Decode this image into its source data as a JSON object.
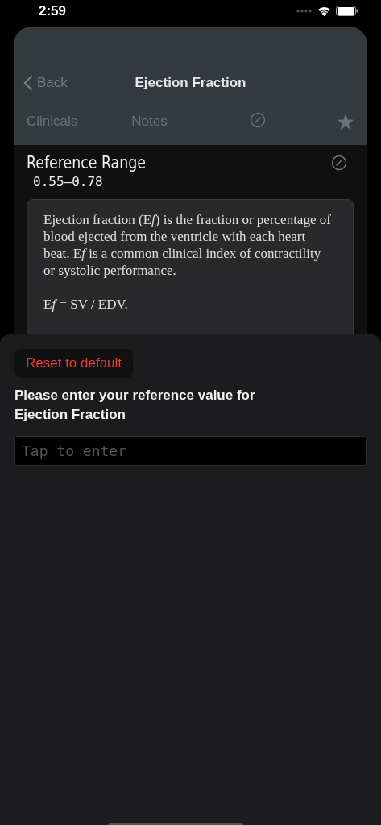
{
  "status_bar": {
    "time": "2:59"
  },
  "nav": {
    "back": "Back",
    "title": "Ejection Fraction"
  },
  "tabs": [
    {
      "label": "Clinicals"
    },
    {
      "label": "Notes"
    }
  ],
  "reference": {
    "title": "Reference Range",
    "value": "0.55–0.78"
  },
  "description": [
    [
      {
        "text": "Ejection fraction (E",
        "italic": false
      },
      {
        "text": "f",
        "italic": true
      },
      {
        "text": ") is the fraction or percentage of blood ejected from the ventricle with each heart beat. E",
        "italic": false
      },
      {
        "text": "f",
        "italic": true
      },
      {
        "text": " is a common clinical index of contractility or systolic performance.",
        "italic": false
      }
    ],
    [
      {
        "text": "E",
        "italic": false
      },
      {
        "text": "f",
        "italic": true
      },
      {
        "text": " = SV / EDV.",
        "italic": false
      }
    ]
  ],
  "sheet": {
    "reset_button": "Reset to default",
    "prompt": "Please enter your reference value for Ejection Fraction",
    "input": {
      "placeholder": "Tap to enter"
    }
  }
}
